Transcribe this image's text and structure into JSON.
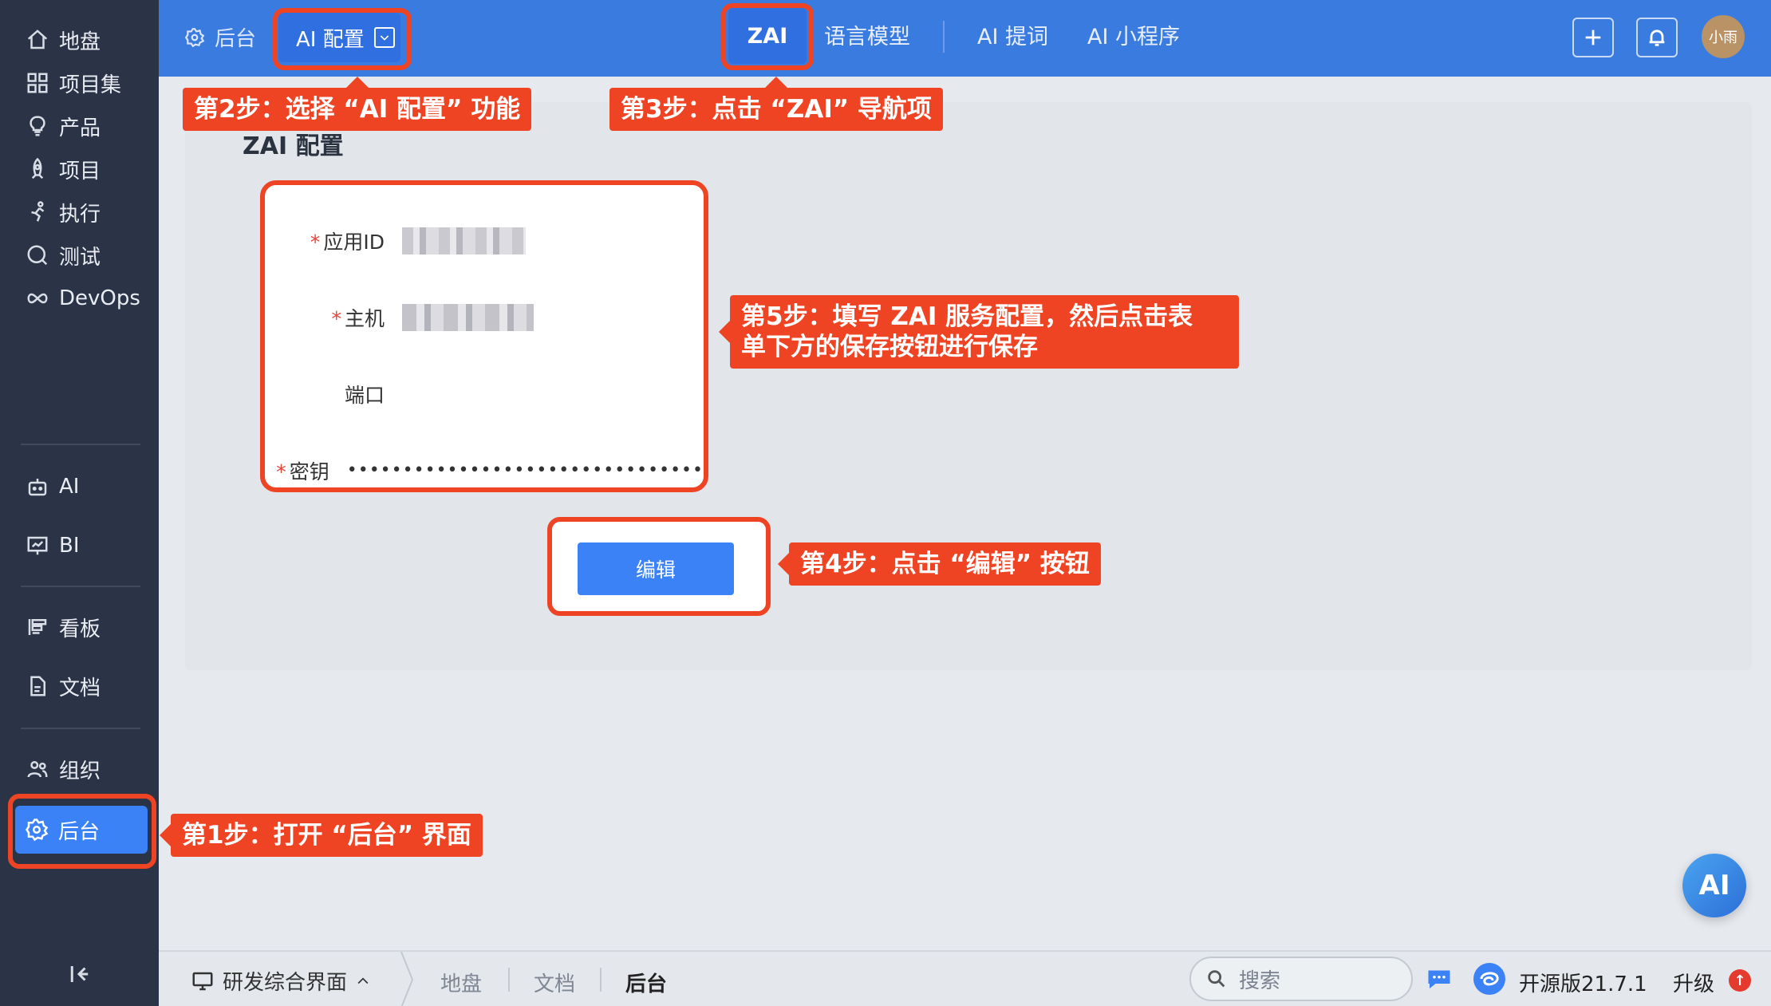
{
  "sidebar": {
    "items": [
      {
        "label": "地盘",
        "icon": "home-icon"
      },
      {
        "label": "项目集",
        "icon": "grid-icon"
      },
      {
        "label": "产品",
        "icon": "lightbulb-icon"
      },
      {
        "label": "项目",
        "icon": "rocket-icon"
      },
      {
        "label": "执行",
        "icon": "run-icon"
      },
      {
        "label": "测试",
        "icon": "search-circle-icon"
      },
      {
        "label": "DevOps",
        "icon": "infinity-icon"
      },
      {
        "label": "AI",
        "icon": "robot-icon"
      },
      {
        "label": "BI",
        "icon": "chart-board-icon"
      },
      {
        "label": "看板",
        "icon": "kanban-icon"
      },
      {
        "label": "文档",
        "icon": "document-icon"
      },
      {
        "label": "组织",
        "icon": "users-icon"
      },
      {
        "label": "后台",
        "icon": "gear-icon",
        "active": true
      }
    ]
  },
  "header": {
    "back_label": "后台",
    "config_label": "AI 配置",
    "tabs": [
      {
        "label": "ZAI",
        "active": true
      },
      {
        "label": "语言模型"
      },
      {
        "label": "AI 提词"
      },
      {
        "label": "AI 小程序"
      }
    ],
    "avatar_text": "小雨"
  },
  "main": {
    "title": "ZAI 配置",
    "form": {
      "app_id_label": "应用ID",
      "host_label": "主机",
      "port_label": "端口",
      "secret_label": "密钥",
      "secret_value": "••••••••••••••••••••••••••••••••"
    },
    "edit_button": "编辑"
  },
  "callouts": {
    "step1": "第1步：打开 “后台” 界面",
    "step2": "第2步：选择 “AI 配置” 功能",
    "step3": "第3步：点击 “ZAI” 导航项",
    "step4": "第4步：点击 “编辑” 按钮",
    "step5_line1": "第5步：填写 ZAI 服务配置，然后点击表",
    "step5_line2": "单下方的保存按钮进行保存"
  },
  "footer": {
    "workspace": "研发综合界面",
    "crumbs": [
      "地盘",
      "文档",
      "后台"
    ],
    "search_placeholder": "搜索",
    "version": "开源版21.7.1",
    "upgrade": "升级"
  },
  "fab": "AI",
  "colors": {
    "accent": "#3b82f6",
    "sidebar_bg": "#2b3446",
    "header_bg": "#3a7be0",
    "annotation": "#ef4424"
  }
}
